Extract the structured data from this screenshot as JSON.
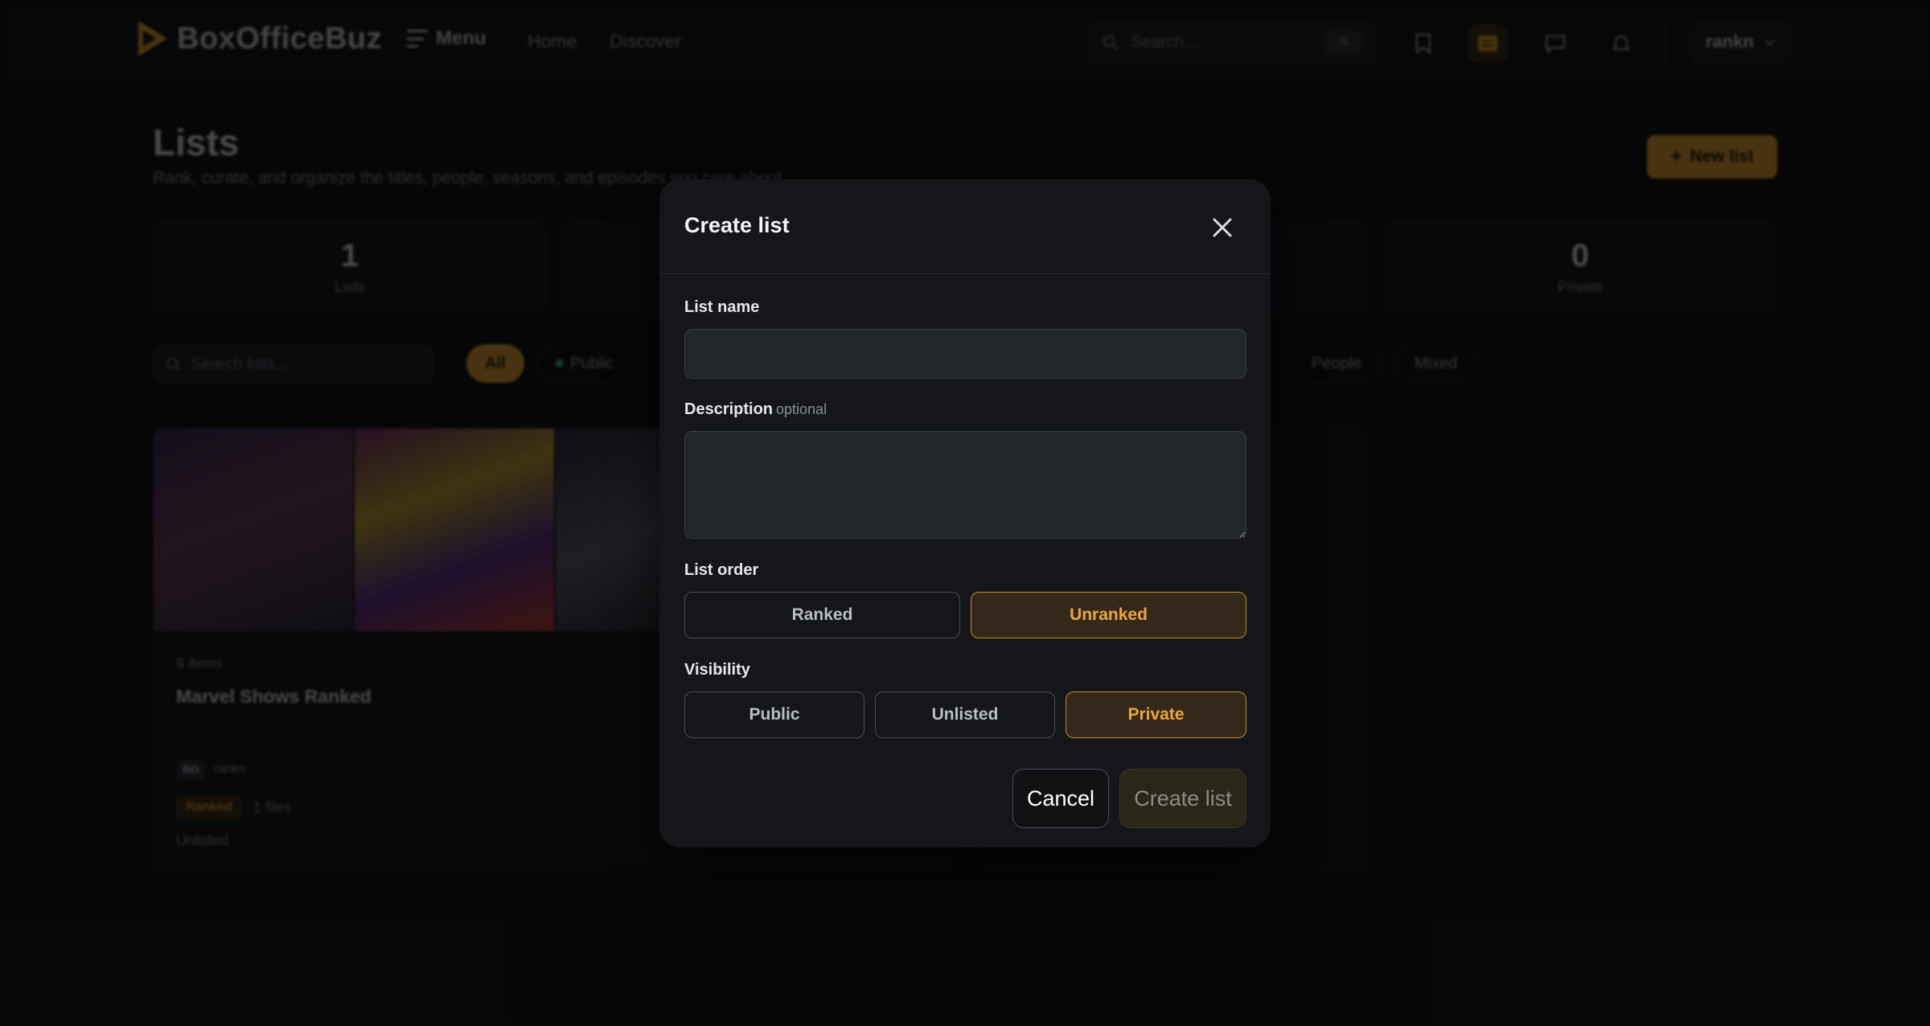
{
  "app": {
    "brand": "BoxOfficeBuz",
    "menu_label": "Menu",
    "nav": [
      "Home",
      "Discover"
    ],
    "search_placeholder": "Search...",
    "search_shortcut": "/K",
    "user": "rankn"
  },
  "page": {
    "title": "Lists",
    "subtitle": "Rank, curate, and organize the titles, people, seasons, and episodes you care about.",
    "new_list_label": "New list",
    "stats": [
      {
        "value": "1",
        "label": "Lists"
      },
      {
        "value": "0",
        "label": "Private"
      }
    ],
    "list_search_placeholder": "Search lists...",
    "filters": [
      "All",
      "Public",
      "People",
      "Mixed"
    ]
  },
  "list_card": {
    "count": "9 items",
    "title": "Marvel Shows Ranked",
    "owner_badge": "RO",
    "owner": "rankn",
    "order_badge": "Ranked",
    "type": "1 files",
    "visibility": "Unlisted"
  },
  "modal": {
    "title": "Create list",
    "name_label": "List name",
    "name_value": "",
    "description_label": "Description",
    "description_optional": "optional",
    "description_value": "",
    "order_label": "List order",
    "order_options": [
      "Ranked",
      "Unranked"
    ],
    "order_selected": "Unranked",
    "visibility_label": "Visibility",
    "visibility_options": [
      "Public",
      "Unlisted",
      "Private"
    ],
    "visibility_selected": "Private",
    "cancel_label": "Cancel",
    "create_label": "Create list"
  },
  "colors": {
    "accent": "#e6a22c",
    "background": "#0b0c0e",
    "modal": "#141619"
  }
}
